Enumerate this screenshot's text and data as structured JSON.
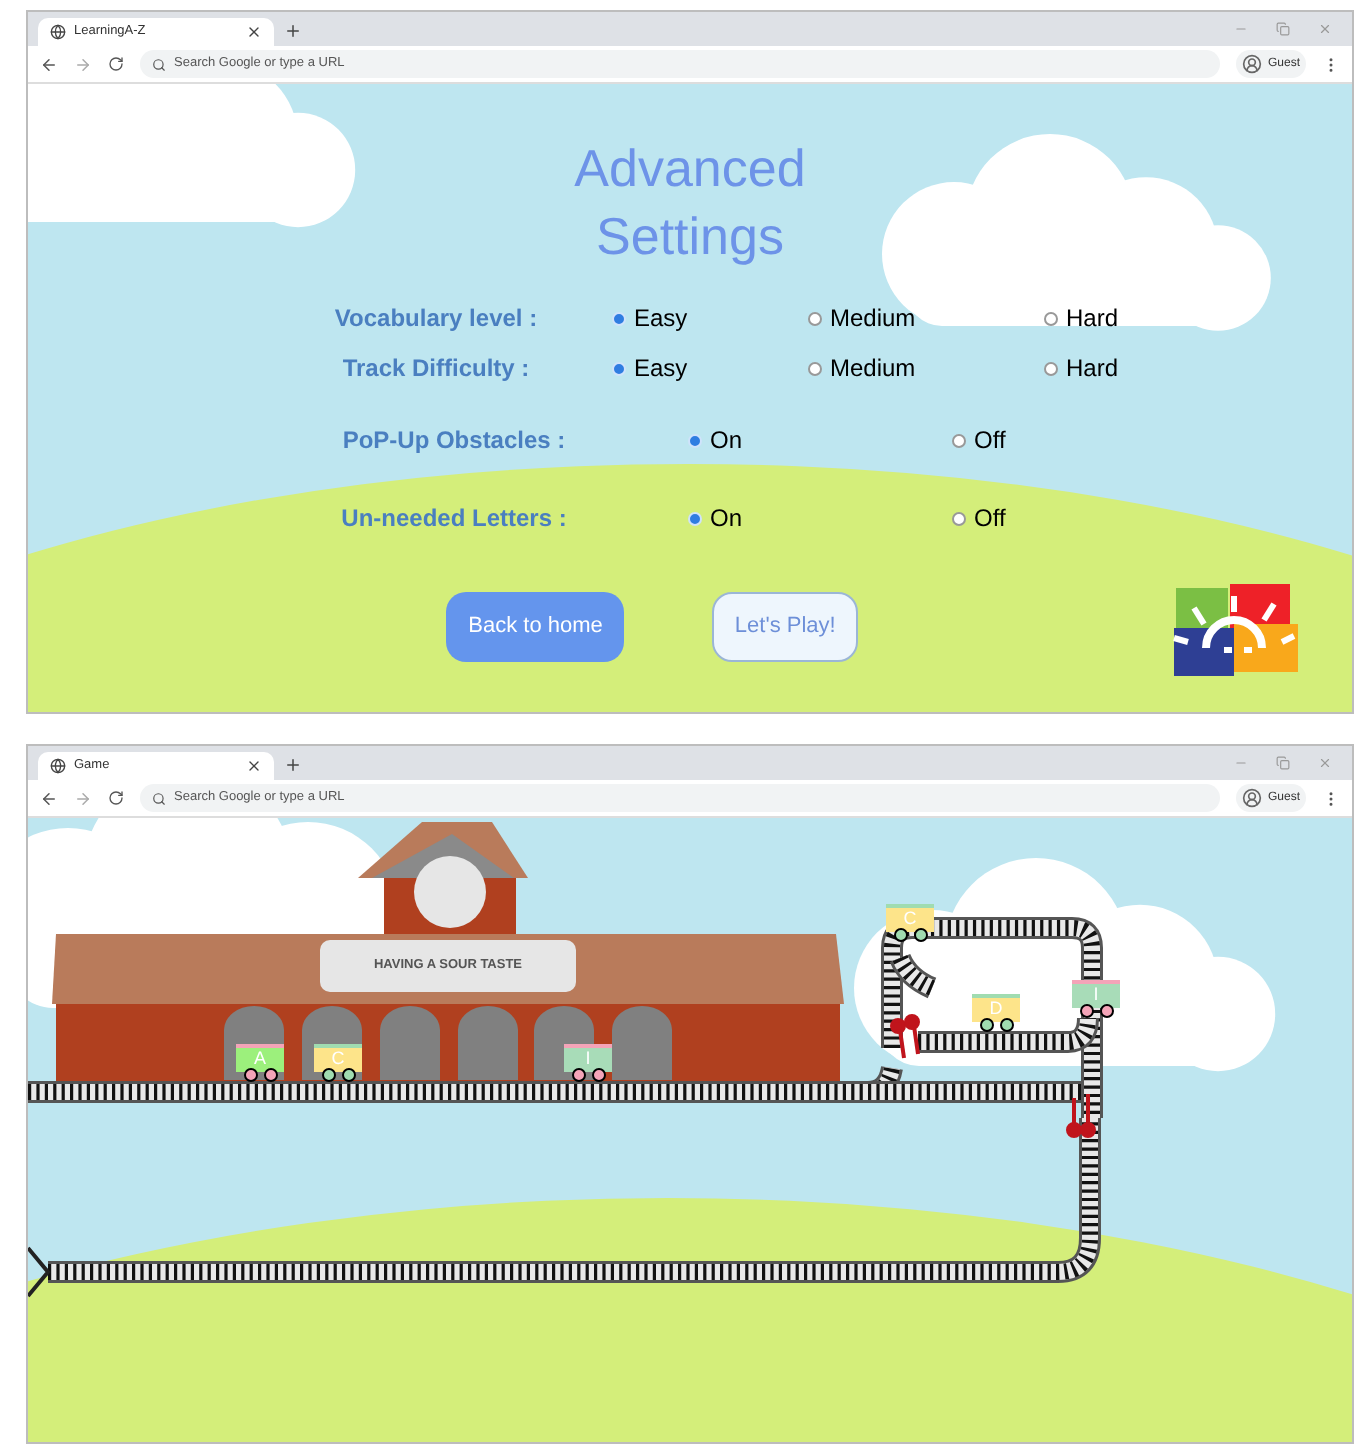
{
  "browser_windows": [
    {
      "tab_title": "LearningA-Z",
      "address_placeholder": "Search Google or type a URL",
      "profile_label": "Guest"
    },
    {
      "tab_title": "Game",
      "address_placeholder": "Search Google or type a URL",
      "profile_label": "Guest"
    }
  ],
  "settings_page": {
    "title": "Advanced Settings",
    "settings": [
      {
        "label": "Vocabulary level :",
        "options": [
          {
            "label": "Easy",
            "selected": true
          },
          {
            "label": "Medium",
            "selected": false
          },
          {
            "label": "Hard",
            "selected": false
          }
        ]
      },
      {
        "label": "Track Difficulty :",
        "options": [
          {
            "label": "Easy",
            "selected": true
          },
          {
            "label": "Medium",
            "selected": false
          },
          {
            "label": "Hard",
            "selected": false
          }
        ]
      },
      {
        "label": "PoP-Up Obstacles :",
        "options": [
          {
            "label": "On",
            "selected": true
          },
          {
            "label": "Off",
            "selected": false
          }
        ]
      },
      {
        "label": "Un-needed Letters :",
        "options": [
          {
            "label": "On",
            "selected": true
          },
          {
            "label": "Off",
            "selected": false
          }
        ]
      }
    ],
    "buttons": [
      {
        "label": "Back to home",
        "kind": "primary"
      },
      {
        "label": "Let's Play!",
        "kind": "secondary"
      }
    ]
  },
  "game_page": {
    "sign": "HAVING A SOUR TASTE",
    "cars": [
      {
        "letter": "A",
        "color": "#9cf07c"
      },
      {
        "letter": "C",
        "color": "#fde48a"
      },
      {
        "letter": "I",
        "color": "#a8dcb8"
      },
      {
        "letter": "C",
        "color": "#fde48a"
      },
      {
        "letter": "D",
        "color": "#fde48a"
      },
      {
        "letter": "I",
        "color": "#a8dcb8"
      }
    ]
  }
}
